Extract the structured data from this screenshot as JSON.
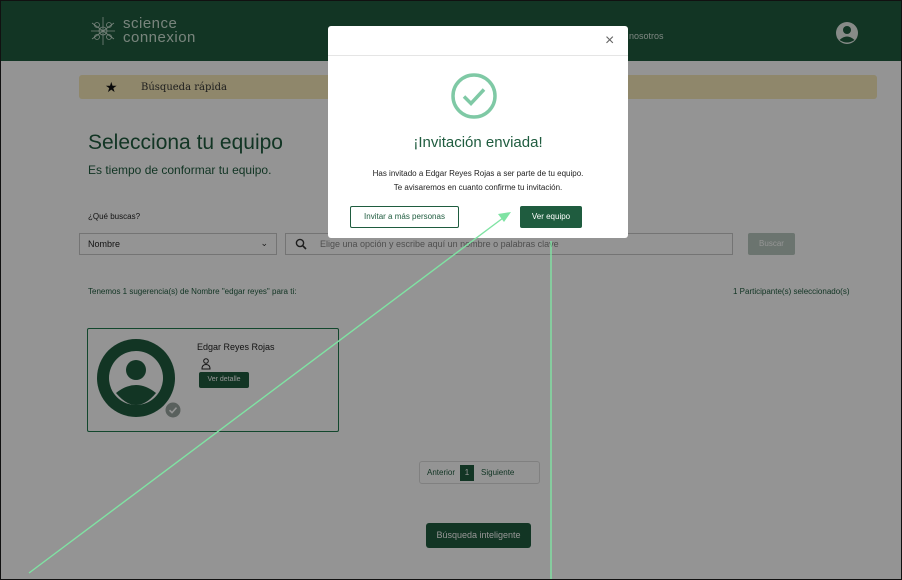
{
  "header": {
    "brand_line1": "science",
    "brand_line2": "connexion",
    "nav_item": "nosotros"
  },
  "quick_search": {
    "label": "Búsqueda rápida"
  },
  "page": {
    "title": "Selecciona tu equipo",
    "subtitle": "Es tiempo de conformar tu equipo.",
    "filter_label": "¿Qué buscas?",
    "filter_select_value": "Nombre",
    "search_placeholder": "Elige una opción y escribe aquí un nombre o palabras clave",
    "search_button": "Buscar",
    "suggestions_text": "Tenemos 1 sugerencia(s) de Nombre \"edgar reyes\" para ti:",
    "selected_count_text": "1 Participante(s) seleccionado(s)"
  },
  "result_card": {
    "name": "Edgar Reyes Rojas",
    "detail_button": "Ver detalle"
  },
  "pagination": {
    "prev_label": "Anterior",
    "current_page": "1",
    "next_label": "Siguiente"
  },
  "smart_search_button": "Búsqueda inteligente",
  "modal": {
    "close_symbol": "×",
    "title": "¡Invitación enviada!",
    "message_line1": "Has invitado a Edgar Reyes Rojas a ser parte de tu equipo.",
    "message_line2": "Te avisaremos en cuanto confirme tu invitación.",
    "invite_more_button": "Invitar a más personas",
    "view_team_button": "Ver equipo"
  },
  "colors": {
    "brand_green": "#1f5c3f",
    "quick_bar": "#f6e8b8",
    "annotation_arrow": "#7fe3a3"
  },
  "icons": [
    "logo-icon",
    "user-icon",
    "star-icon",
    "chevron-down-icon",
    "search-icon",
    "avatar-icon",
    "check-icon",
    "person-icon",
    "close-icon",
    "success-check-icon"
  ]
}
